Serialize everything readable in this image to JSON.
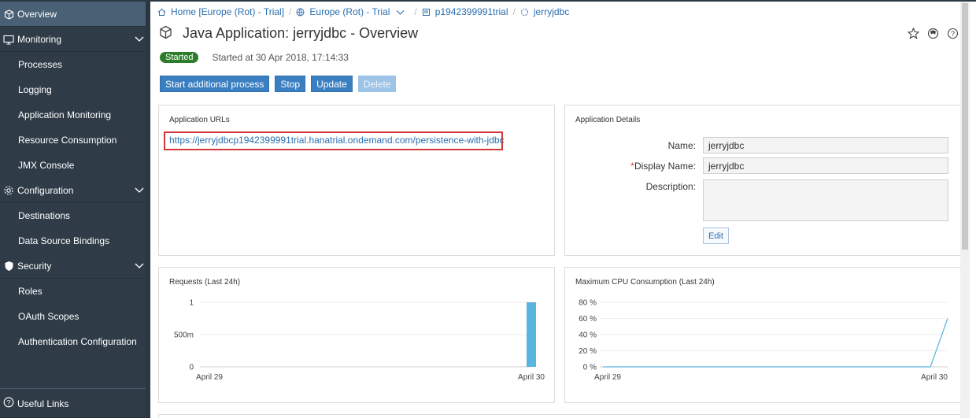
{
  "sidebar": {
    "items": [
      {
        "label": "Overview",
        "selected": true,
        "icon": "cube-icon"
      },
      {
        "label": "Monitoring",
        "icon": "monitor-icon",
        "expanded": true
      },
      {
        "label": "Processes"
      },
      {
        "label": "Logging"
      },
      {
        "label": "Application Monitoring"
      },
      {
        "label": "Resource Consumption"
      },
      {
        "label": "JMX Console"
      },
      {
        "label": "Configuration",
        "icon": "gear-icon",
        "expanded": true
      },
      {
        "label": "Destinations"
      },
      {
        "label": "Data Source Bindings"
      },
      {
        "label": "Security",
        "icon": "shield-icon",
        "expanded": true
      },
      {
        "label": "Roles"
      },
      {
        "label": "OAuth Scopes"
      },
      {
        "label": "Authentication Configuration"
      }
    ],
    "useful_links": "Useful Links"
  },
  "breadcrumb": {
    "home": "Home [Europe (Rot) - Trial]",
    "region": "Europe (Rot) - Trial",
    "account": "p1942399991trial",
    "app": "jerryjdbc"
  },
  "header": {
    "title": "Java Application: jerryjdbc - Overview"
  },
  "status": {
    "badge": "Started",
    "started_text": "Started at 30 Apr 2018, 17:14:33"
  },
  "actions": {
    "start": "Start additional process",
    "stop": "Stop",
    "update": "Update",
    "delete": "Delete"
  },
  "urls_panel": {
    "title": "Application URLs",
    "url": "https://jerryjdbcp1942399991trial.hanatrial.ondemand.com/persistence-with-jdbc"
  },
  "details_panel": {
    "title": "Application Details",
    "name_label": "Name:",
    "name_value": "jerryjdbc",
    "required_mark": "*",
    "display_label": "Display Name:",
    "display_value": "jerryjdbc",
    "description_label": "Description:",
    "description_value": "",
    "edit": "Edit"
  },
  "colors": {
    "sidebar_bg": "#2f3c48",
    "selected_bg": "#4a6175",
    "button_blue": "#3a7fc1",
    "started_green": "#2b7d2b",
    "chart_blue": "#5ab4e0",
    "highlight_red": "#d23a3a"
  },
  "chart_data": [
    {
      "type": "bar",
      "title": "Requests (Last 24h)",
      "x": [
        "April 29",
        "April 30"
      ],
      "x_tick_labels": [
        "April 29",
        "April 30"
      ],
      "y_tick_labels": [
        "0",
        "500m",
        "1"
      ],
      "ylim": [
        0,
        1
      ],
      "series": [
        {
          "values": [
            0,
            1
          ]
        }
      ],
      "grid": true
    },
    {
      "type": "line",
      "title": "Maximum CPU Consumption (Last 24h)",
      "x_tick_labels": [
        "April 29",
        "April 30"
      ],
      "y_tick_labels": [
        "0 %",
        "20 %",
        "40 %",
        "60 %",
        "80 %"
      ],
      "ylim": [
        0,
        80
      ],
      "series": [
        {
          "x": [
            0,
            0.95,
            1
          ],
          "values": [
            0,
            0,
            60
          ]
        }
      ],
      "grid": true
    }
  ]
}
